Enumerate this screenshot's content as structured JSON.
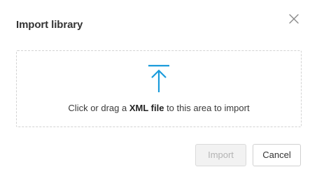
{
  "dialog": {
    "title": "Import library",
    "close_icon": "close-icon"
  },
  "dropzone": {
    "icon": "upload-arrow-icon",
    "text_before": "Click or drag a ",
    "text_bold": "XML file",
    "text_after": " to this area to import",
    "accent_color": "#1a9bdb"
  },
  "footer": {
    "import_label": "Import",
    "import_disabled": true,
    "cancel_label": "Cancel"
  }
}
